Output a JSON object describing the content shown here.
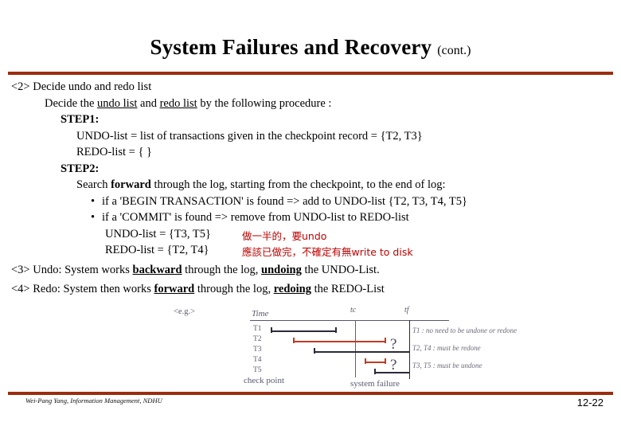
{
  "title": {
    "main": "System Failures and Recovery",
    "cont": "(cont.)"
  },
  "colors": {
    "rule": "#9B2D0F",
    "annotation_red": "#C00000",
    "diagram_red": "#C23B22"
  },
  "content": {
    "l1": "<2> Decide undo and redo list",
    "l2_a": "Decide the ",
    "l2_b": "undo list",
    "l2_c": " and ",
    "l2_d": "redo list",
    "l2_e": " by the following procedure :",
    "l3": "STEP1:",
    "l4": "UNDO-list = list of transactions given in the checkpoint record = {T2, T3}",
    "l5": "REDO-list = { }",
    "l6": "STEP2:",
    "l7_a": "Search ",
    "l7_b": "forward",
    "l7_c": " through the log, starting from the checkpoint, to the end of log:",
    "l8": "if a 'BEGIN TRANSACTION' is found => add to UNDO-list  {T2, T3, T4, T5}",
    "l9": "if a 'COMMIT' is found => remove from UNDO-list to REDO-list",
    "l10": "UNDO-list = {T3, T5}",
    "l11": "REDO-list = {T2, T4}",
    "note1": "做一半的，要undo",
    "note2": "應該已做完，不確定有無write to disk",
    "l12_a": "<3> Undo: System works ",
    "l12_b": "backward",
    "l12_c": " through the log, ",
    "l12_d": "undoing",
    "l12_e": " the UNDO-List.",
    "l13_a": "<4> Redo: System then works ",
    "l13_b": "forward",
    "l13_c": " through the log, ",
    "l13_d": "redoing",
    "l13_e": " the REDO-List"
  },
  "diagram": {
    "eg_label": "<e.g.>",
    "time_label": "Time",
    "tc_label": "tc",
    "tf_label": "tf",
    "checkpoint_label": "check point",
    "sysfailure_label": "system failure",
    "rows": [
      "T1",
      "T2",
      "T3",
      "T4",
      "T5"
    ],
    "right_notes": [
      "T1 : no need to be undone or redone",
      "T2, T4 : must be redone",
      "T3, T5 : must be undone"
    ],
    "question_marks": [
      "?",
      "?"
    ]
  },
  "footer": {
    "credit": "Wei-Pang Yang, Information Management, NDHU",
    "page": "12-22"
  }
}
